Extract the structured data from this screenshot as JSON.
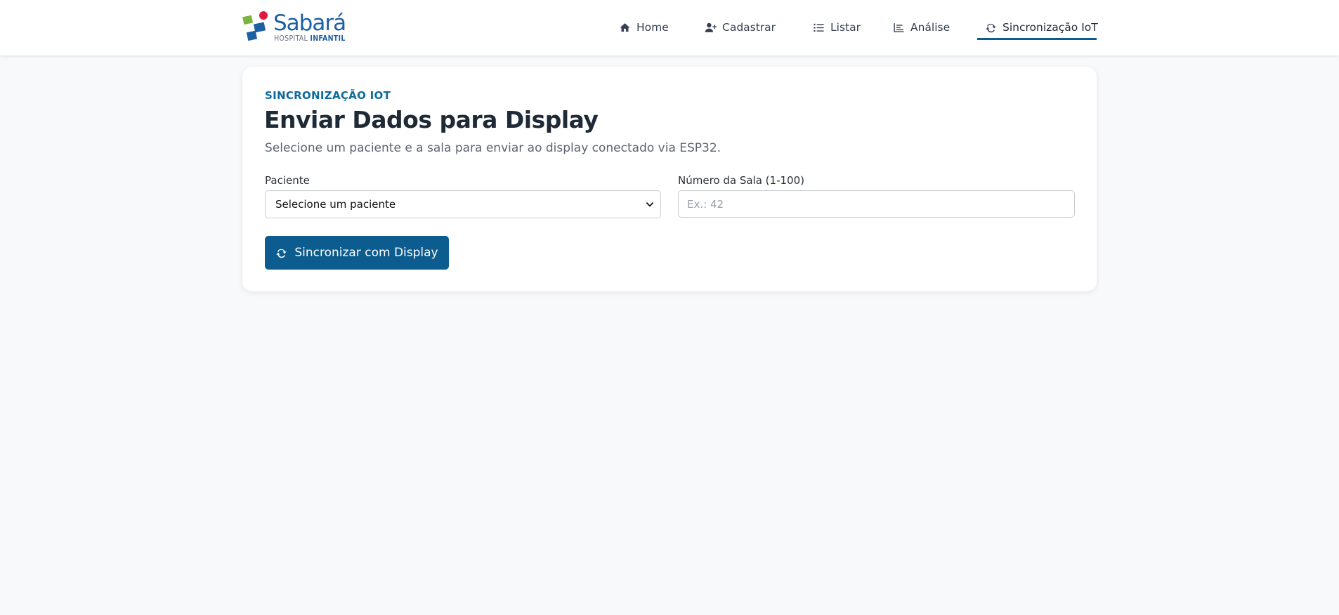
{
  "brand": {
    "name": "Sabará",
    "subtitle_a": "HOSPITAL",
    "subtitle_b": "INFANTIL"
  },
  "nav": {
    "items": [
      {
        "label": "Home",
        "icon": "home-icon"
      },
      {
        "label": "Cadastrar",
        "icon": "user-plus-icon"
      },
      {
        "label": "Listar",
        "icon": "list-icon"
      },
      {
        "label": "Análise",
        "icon": "chart-icon"
      },
      {
        "label": "Sincronização IoT",
        "icon": "sync-icon",
        "active": true
      }
    ]
  },
  "card": {
    "eyebrow": "SINCRONIZAÇÃO IOT",
    "title": "Enviar Dados para Display",
    "subtitle": "Selecione um paciente e a sala para enviar ao display conectado via ESP32.",
    "patient_label": "Paciente",
    "patient_value": "Selecione um paciente",
    "room_label": "Número da Sala (1-100)",
    "room_placeholder": "Ex.: 42",
    "button_label": "Sincronizar com Display"
  },
  "colors": {
    "accent": "#0d5c8f",
    "eyebrow": "#0d6a9e",
    "background": "#f8f9fb"
  }
}
